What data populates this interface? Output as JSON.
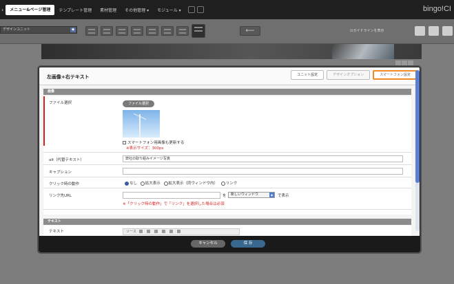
{
  "topnav": {
    "items": [
      {
        "label": "メニュー&ページ管理",
        "active": true
      },
      {
        "label": "テンプレート管理",
        "active": false
      },
      {
        "label": "素材管理",
        "active": false
      },
      {
        "label": "その他管理 ▾",
        "active": false
      },
      {
        "label": "モジュール ▾",
        "active": false
      }
    ],
    "brand": "bingo!CI"
  },
  "toolbar": {
    "unit_select": "デザインユニット",
    "back_arrow": "⟵",
    "guide_toggle": "☑ガイドラインを表示"
  },
  "modal": {
    "title": "左画像+右テキスト",
    "tabs": [
      {
        "label": "ユニット設定",
        "state": "active"
      },
      {
        "label": "デザインオプション",
        "state": "inactive"
      },
      {
        "label": "スマートフォン設定",
        "state": "highlight"
      }
    ],
    "sections": {
      "image": "画像",
      "text": "テキスト"
    },
    "fields": {
      "file_label": "ファイル選択",
      "file_button": "ファイル選択",
      "sp_update": "スマートフォン用画像も更新する",
      "size_note": "※表示サイズ：300px",
      "alt_label": "alt（代替テキスト）",
      "alt_value": "弊社の取り組みイメージ写真",
      "caption_label": "キャプション",
      "caption_value": "",
      "click_label": "クリック時の動作",
      "click_options": [
        "なし",
        "拡大表示",
        "拡大表示（同ウィンドウ内）",
        "リンク"
      ],
      "click_selected": 0,
      "url_label": "リンク先URL",
      "url_value": "",
      "url_wo": "を",
      "window_select": "新しいウィンドウ",
      "url_hyouji": "で表示",
      "url_note": "※「クリック時の動作」で「リンク」を選択した場合は必須",
      "text_label": "テキスト",
      "editor_source": "ソース"
    },
    "buttons": {
      "cancel": "キャンセル",
      "save": "保 存"
    }
  },
  "colors": {
    "accent_orange": "#ef8a26",
    "required_red": "#d32020",
    "save_blue": "#39688f",
    "scroll_blue": "#5a7fd6"
  }
}
